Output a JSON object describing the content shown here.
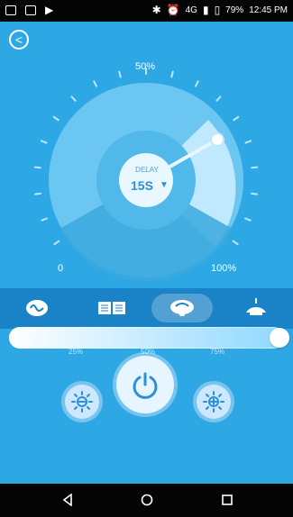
{
  "status_bar": {
    "battery_percent": "79%",
    "time": "12:45 PM",
    "network": "4G"
  },
  "header": {
    "back_label": "Back"
  },
  "dial": {
    "percent_label": "50%",
    "min_label": "0",
    "max_label": "100%",
    "delay_label": "DELAY",
    "delay_value": "15S",
    "value": 0.5
  },
  "modes": {
    "items": [
      {
        "name": "wave-mode"
      },
      {
        "name": "book-mode"
      },
      {
        "name": "fan-mode"
      },
      {
        "name": "ceiling-light-mode"
      }
    ],
    "selected_index": 2
  },
  "brightness_slider": {
    "tick_labels": [
      "25%",
      "50%",
      "75%"
    ],
    "value": 1
  },
  "colors": {
    "background": "#2ea7e5",
    "band": "#1a82c6",
    "accent": "#ffffff"
  }
}
